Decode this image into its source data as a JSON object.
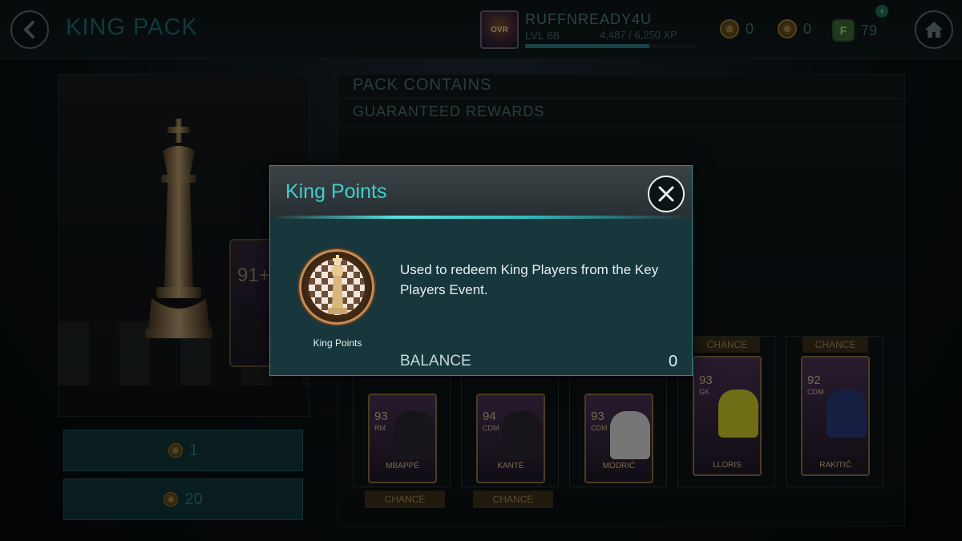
{
  "header": {
    "title": "KING PACK",
    "username": "RUFFNREADY4U",
    "level": "LVL 68",
    "xp": "4,487 / 6,250 XP",
    "xp_progress": 0.72,
    "avatar_text": "OVR",
    "currency_1": "0",
    "currency_2": "0",
    "fifa_points": "79",
    "fifa_points_icon": "F"
  },
  "left_panel": {
    "card_rating": "91+",
    "buy_options": [
      {
        "price": "1",
        "icon": "king-points-coin-icon"
      },
      {
        "price": "20",
        "icon": "king-points-coin-icon"
      }
    ]
  },
  "right_panel": {
    "section_1": "PACK CONTAINS",
    "section_2": "GUARANTEED REWARDS",
    "chance_label": "CHANCE",
    "players": [
      {
        "name": "MBAPPÉ",
        "rating": "93",
        "pos": "RM"
      },
      {
        "name": "KANTÉ",
        "rating": "94",
        "pos": "CDM"
      },
      {
        "name": "MODRIĆ",
        "rating": "93",
        "pos": "CDM"
      },
      {
        "name": "LLORIS",
        "rating": "93",
        "pos": "GK"
      },
      {
        "name": "RAKITIĆ",
        "rating": "92",
        "pos": "CDM"
      }
    ]
  },
  "modal": {
    "title": "King Points",
    "icon_caption": "King Points",
    "description": "Used to redeem King Players from the Key Players Event.",
    "balance_label": "BALANCE",
    "balance_value": "0"
  },
  "colors": {
    "accent": "#3ed0d2",
    "modal_bg": "#17373d",
    "gold": "#c08e5a"
  }
}
